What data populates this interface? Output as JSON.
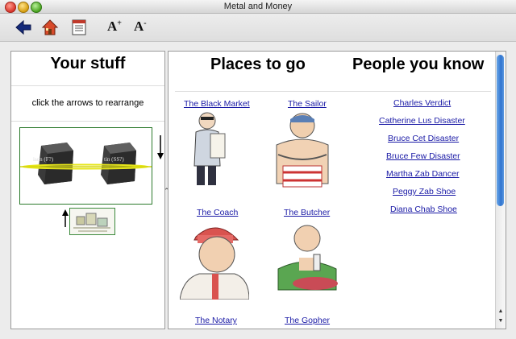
{
  "window": {
    "title": "Metal and Money"
  },
  "toolbar": {
    "back_icon": "back-arrow-icon",
    "home_icon": "home-icon",
    "notes_icon": "notes-icon",
    "font_increase": "A",
    "font_increase_sup": "+",
    "font_decrease": "A",
    "font_decrease_sup": "-"
  },
  "left": {
    "title": "Your stuff",
    "hint": "click the arrows to rearrange",
    "stone1_label": "ison (F?)",
    "stone2_label": "tin (SS?)"
  },
  "places": {
    "title": "Places to go",
    "items": [
      "The Black Market",
      "The Sailor",
      "The Coach",
      "The Butcher",
      "The Notary",
      "The Gopher"
    ]
  },
  "people": {
    "title": "People you know",
    "items": [
      "Charles Verdict",
      "Catherine Lus Disaster",
      "Bruce Cet Disaster",
      "Bruce Few Disaster",
      "Martha Zab Dancer",
      "Peggy Zab Shoe",
      "Diana Chab Shoe"
    ]
  },
  "colors": {
    "link": "#1a1aa6",
    "arrange_border": "#2c7a2c",
    "scroll_thumb": "#2f73cf"
  }
}
